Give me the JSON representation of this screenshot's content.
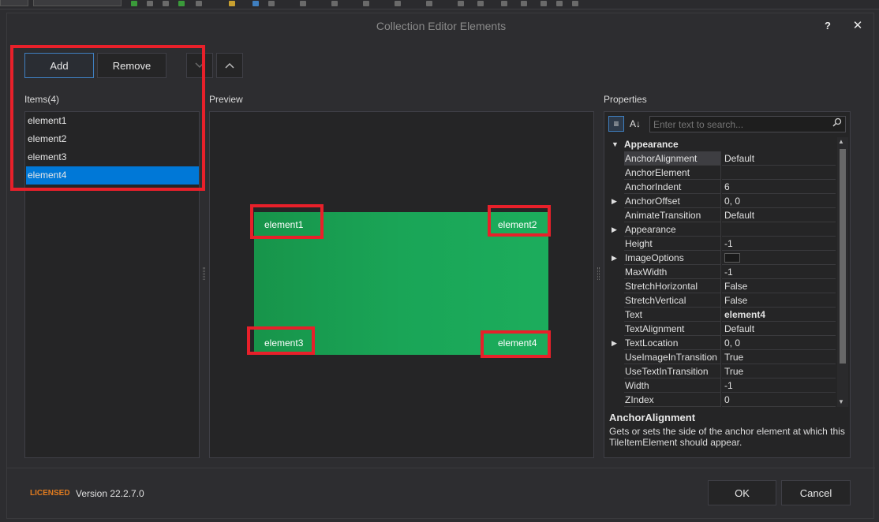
{
  "host_toolbar": {
    "combo1_value": "",
    "combo2_value": ""
  },
  "dialog": {
    "title": "Collection Editor Elements",
    "help_label": "?",
    "close_label": "✕"
  },
  "toolbar": {
    "add_label": "Add",
    "remove_label": "Remove",
    "move_down_label": "⌄",
    "move_up_label": "⌃"
  },
  "items": {
    "label": "Items(4)",
    "list": [
      "element1",
      "element2",
      "element3",
      "element4"
    ],
    "selected": "element4"
  },
  "preview": {
    "label": "Preview",
    "tile_elements": [
      "element1",
      "element2",
      "element3",
      "element4"
    ],
    "tile_color": "#1aa557"
  },
  "properties": {
    "label": "Properties",
    "search_placeholder": "Enter text to search...",
    "category": "Appearance",
    "rows": [
      {
        "name": "AnchorAlignment",
        "value": "Default"
      },
      {
        "name": "AnchorElement",
        "value": ""
      },
      {
        "name": "AnchorIndent",
        "value": "6"
      },
      {
        "name": "AnchorOffset",
        "value": "0, 0"
      },
      {
        "name": "AnimateTransition",
        "value": "Default"
      },
      {
        "name": "Appearance",
        "value": ""
      },
      {
        "name": "Height",
        "value": "-1"
      },
      {
        "name": "ImageOptions",
        "value": ""
      },
      {
        "name": "MaxWidth",
        "value": "-1"
      },
      {
        "name": "StretchHorizontal",
        "value": "False"
      },
      {
        "name": "StretchVertical",
        "value": "False"
      },
      {
        "name": "Text",
        "value": "element4"
      },
      {
        "name": "TextAlignment",
        "value": "Default"
      },
      {
        "name": "TextLocation",
        "value": "0, 0"
      },
      {
        "name": "UseImageInTransition",
        "value": "True"
      },
      {
        "name": "UseTextInTransition",
        "value": "True"
      },
      {
        "name": "Width",
        "value": "-1"
      },
      {
        "name": "ZIndex",
        "value": "0"
      }
    ],
    "description_title": "AnchorAlignment",
    "description_text": "Gets or sets the side of the anchor element at which this TileItemElement should appear."
  },
  "footer": {
    "licensed_label": "LICENSED",
    "version": "Version 22.2.7.0",
    "ok_label": "OK",
    "cancel_label": "Cancel"
  },
  "colors": {
    "accent": "#0078d7",
    "highlight": "#e8202a",
    "licensed": "#e07b1f"
  }
}
